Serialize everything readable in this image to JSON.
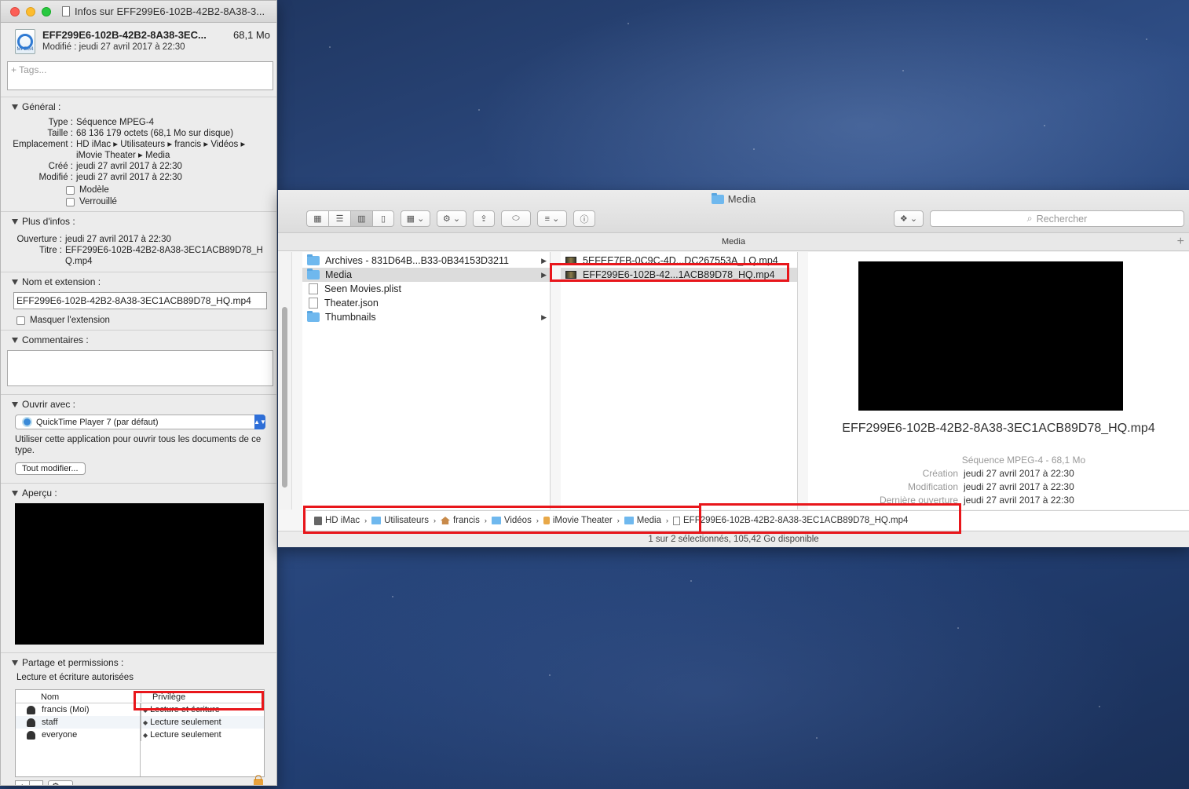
{
  "info_window": {
    "title": "Infos sur EFF299E6-102B-42B2-8A38-3...",
    "file_icon_label": "MPEG4",
    "file_name": "EFF299E6-102B-42B2-8A38-3EC...",
    "file_size": "68,1 Mo",
    "modified_line": "Modifié :  jeudi 27 avril 2017 à 22:30",
    "tags_placeholder": "+ Tags...",
    "general": {
      "title": "Général :",
      "type_k": "Type :",
      "type_v": "Séquence MPEG-4",
      "size_k": "Taille :",
      "size_v": "68 136 179 octets (68,1 Mo sur disque)",
      "where_k": "Emplacement :",
      "where_v": "HD iMac ▸ Utilisateurs ▸ francis ▸ Vidéos ▸ iMovie Theater ▸ Media",
      "created_k": "Créé :",
      "created_v": "jeudi 27 avril 2017 à 22:30",
      "modified_k": "Modifié :",
      "modified_v": "jeudi 27 avril 2017 à 22:30",
      "template_label": "Modèle",
      "locked_label": "Verrouillé"
    },
    "more_info": {
      "title": "Plus d'infos :",
      "opened_k": "Ouverture :",
      "opened_v": "jeudi 27 avril 2017 à 22:30",
      "title_k": "Titre :",
      "title_v": "EFF299E6-102B-42B2-8A38-3EC1ACB89D78_HQ.mp4"
    },
    "name_ext": {
      "title": "Nom et extension :",
      "value": "EFF299E6-102B-42B2-8A38-3EC1ACB89D78_HQ.mp4",
      "hide_label": "Masquer l'extension"
    },
    "comments": {
      "title": "Commentaires :"
    },
    "open_with": {
      "title": "Ouvrir avec :",
      "app": "QuickTime Player 7 (par défaut)",
      "description": "Utiliser cette application pour ouvrir tous les documents de ce type.",
      "change_all": "Tout modifier..."
    },
    "preview": {
      "title": "Aperçu :"
    },
    "sharing": {
      "title": "Partage et permissions :",
      "summary": "Lecture et écriture autorisées",
      "col_name": "Nom",
      "col_priv": "Privilège",
      "rows": [
        {
          "name": "francis (Moi)",
          "priv": "Lecture et écriture"
        },
        {
          "name": "staff",
          "priv": "Lecture seulement"
        },
        {
          "name": "everyone",
          "priv": "Lecture seulement"
        }
      ],
      "add": "+",
      "remove": "−",
      "gear": "⚙ ⌄"
    }
  },
  "finder": {
    "title": "Media",
    "search_placeholder": "Rechercher",
    "path_title": "Media",
    "plus": "+",
    "col1": [
      {
        "name": "Archives - 831D64B...B33-0B34153D3211",
        "kind": "folder",
        "arrow": "▶"
      },
      {
        "name": "Media",
        "kind": "folder",
        "arrow": "▶"
      },
      {
        "name": "Seen Movies.plist",
        "kind": "file",
        "arrow": ""
      },
      {
        "name": "Theater.json",
        "kind": "file",
        "arrow": ""
      },
      {
        "name": "Thumbnails",
        "kind": "folder",
        "arrow": "▶"
      }
    ],
    "col2": [
      {
        "name": "5EFEE7FB-0C9C-4D...DC267553A_LQ.mp4"
      },
      {
        "name": "EFF299E6-102B-42...1ACB89D78_HQ.mp4"
      }
    ],
    "preview": {
      "name": "EFF299E6-102B-42B2-8A38-3EC1ACB89D78_HQ.mp4",
      "type": "Séquence MPEG-4 - 68,1 Mo",
      "created_k": "Création",
      "created_v": "jeudi 27 avril 2017 à 22:30",
      "modified_k": "Modification",
      "modified_v": "jeudi 27 avril 2017 à 22:30",
      "opened_k": "Dernière ouverture",
      "opened_v": "jeudi 27 avril 2017 à 22:30"
    },
    "path": [
      "HD iMac",
      "Utilisateurs",
      "francis",
      "Vidéos",
      "iMovie Theater",
      "Media",
      "EFF299E6-102B-42B2-8A38-3EC1ACB89D78_HQ.mp4"
    ],
    "path_sep": "›",
    "status": "1 sur 2 sélectionnés, 105,42 Go disponible"
  }
}
